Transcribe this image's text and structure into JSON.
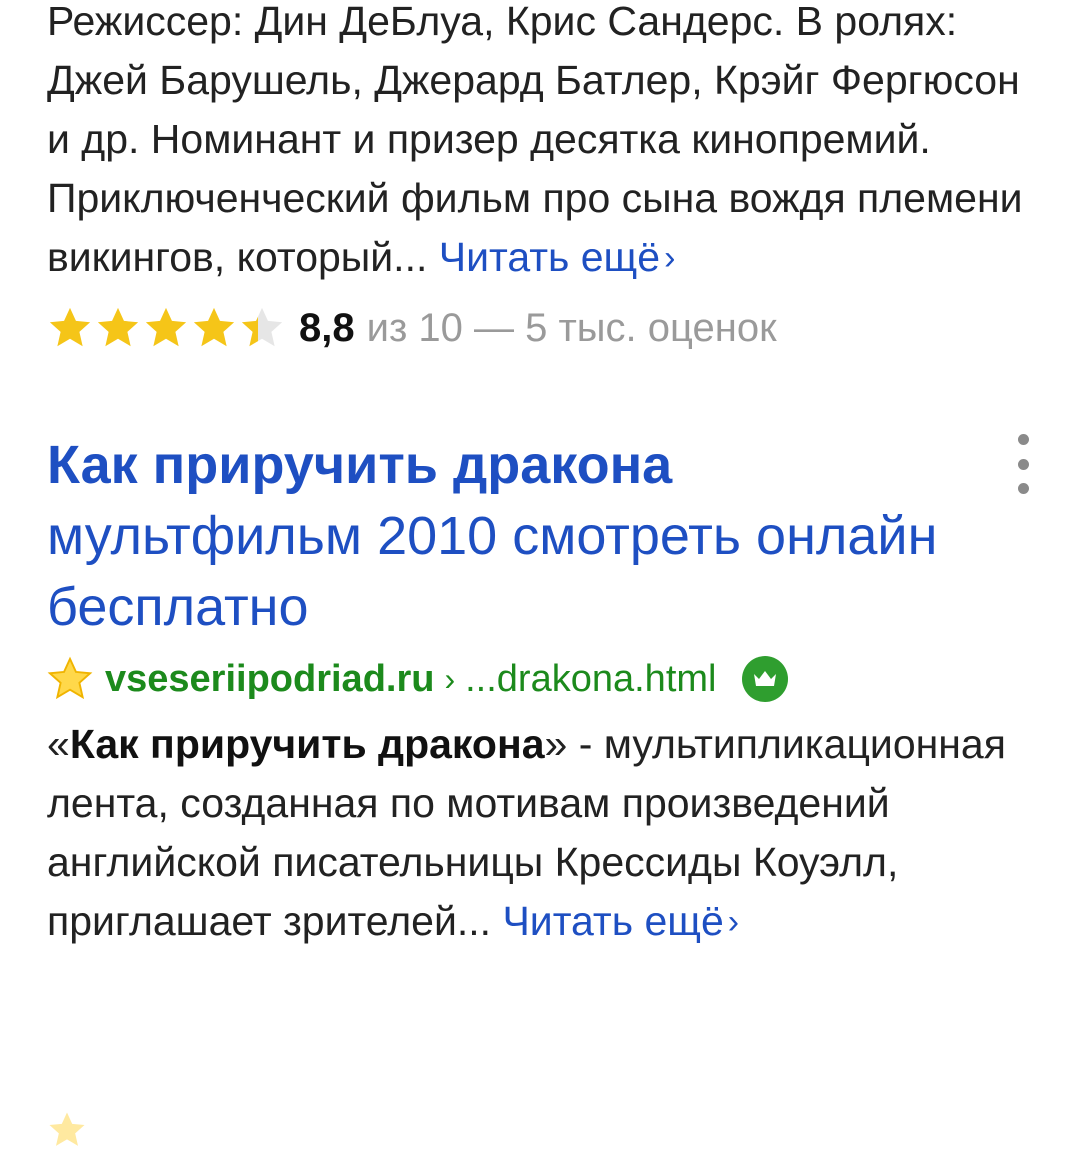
{
  "prev_result": {
    "snippet": "Режиссер: Дин ДеБлуа, Крис Сандерс. В ролях: Джей Барушель, Джерард Батлер, Крэйг Фергюсон и др. Номинант и призер десятка кинопремий. Приключенческий фильм про сына вождя племени викингов, который...",
    "read_more": "Читать ещё",
    "read_more_icon": "chevron-right-icon",
    "rating": {
      "stars_filled": 4.4,
      "stars_total": 5,
      "value": "8,8",
      "rest": "из 10 — 5 тыс. оценок",
      "star_color": "#f5c518",
      "star_empty_color": "#e6e6e6"
    }
  },
  "result": {
    "title_bold": "Как приручить дракона",
    "title_rest": "мультфильм 2010 смотреть онлайн бесплатно",
    "menu_icon": "more-vertical-icon",
    "favicon": "star-favicon-icon",
    "domain": "vseseriipodriad.ru",
    "separator": "›",
    "path": "...drakona.html",
    "badge_icon": "crown-icon",
    "snippet_quote_open": "«",
    "snippet_bold": "Как приручить дракона",
    "snippet_quote_close": "»",
    "snippet_rest": " - мультипликационная лента, созданная по мотивам произведений английской писательницы Крессиды Коуэлл, приглашает зрителей...",
    "read_more": "Читать ещё",
    "read_more_icon": "chevron-right-icon"
  },
  "colors": {
    "link_blue": "#1e4fc2",
    "url_green": "#1c8a1c",
    "badge_green": "#2f9e2f",
    "muted_gray": "#9a9a9a"
  }
}
